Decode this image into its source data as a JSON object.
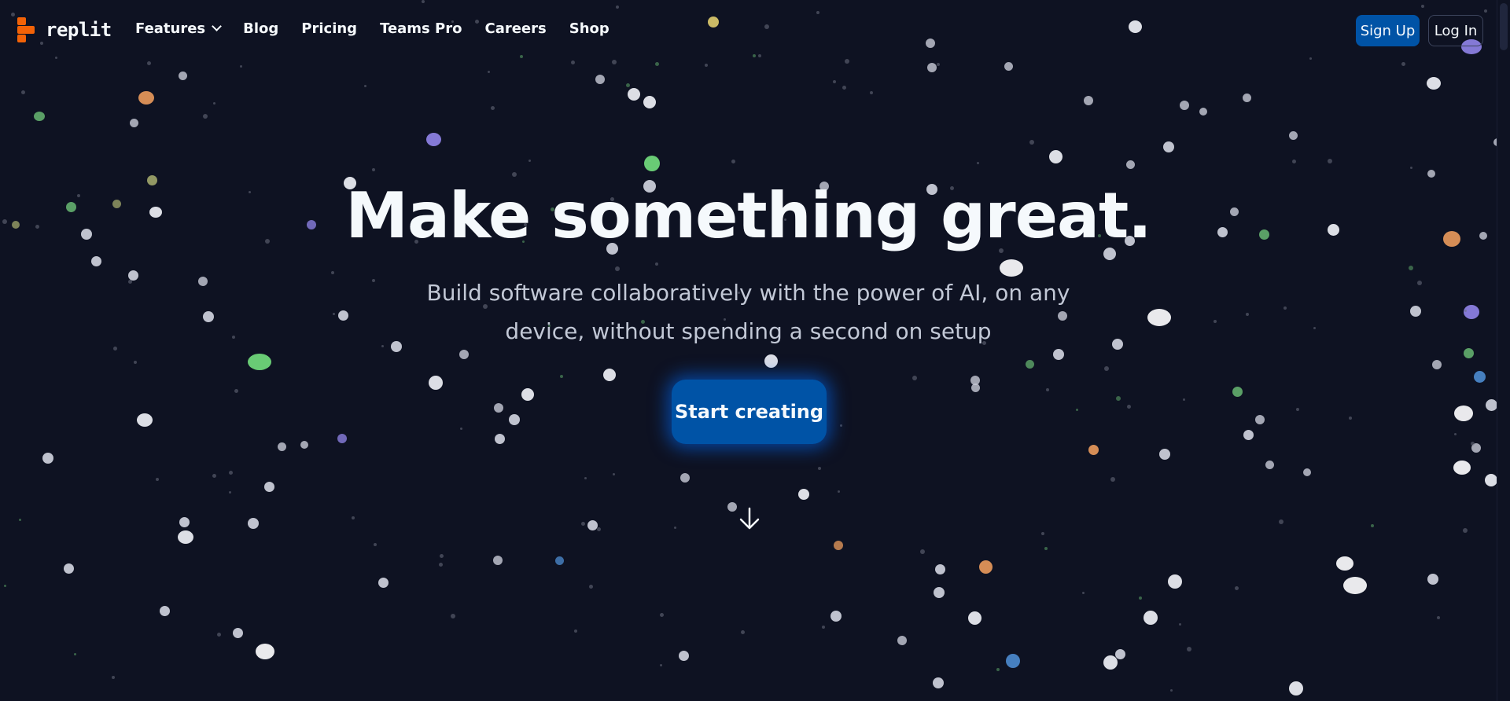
{
  "nav": {
    "logo_text": "replit",
    "links": [
      {
        "label": "Features",
        "has_dropdown": true
      },
      {
        "label": "Blog"
      },
      {
        "label": "Pricing"
      },
      {
        "label": "Teams Pro"
      },
      {
        "label": "Careers"
      },
      {
        "label": "Shop"
      }
    ],
    "signup_label": "Sign Up",
    "login_label": "Log In"
  },
  "hero": {
    "title": "Make something great.",
    "subtitle": "Build software collaboratively with the power of AI, on any device, without spending a second on setup",
    "cta_label": "Start creating"
  },
  "colors": {
    "background": "#0e1222",
    "accent_blue": "#0053a6",
    "logo_orange": "#f26207",
    "text": "#f5f9fc",
    "subtext": "#c2c8d6"
  },
  "icons": {
    "features_dropdown": "chevron-down-icon",
    "scroll_down": "arrow-down-icon"
  }
}
